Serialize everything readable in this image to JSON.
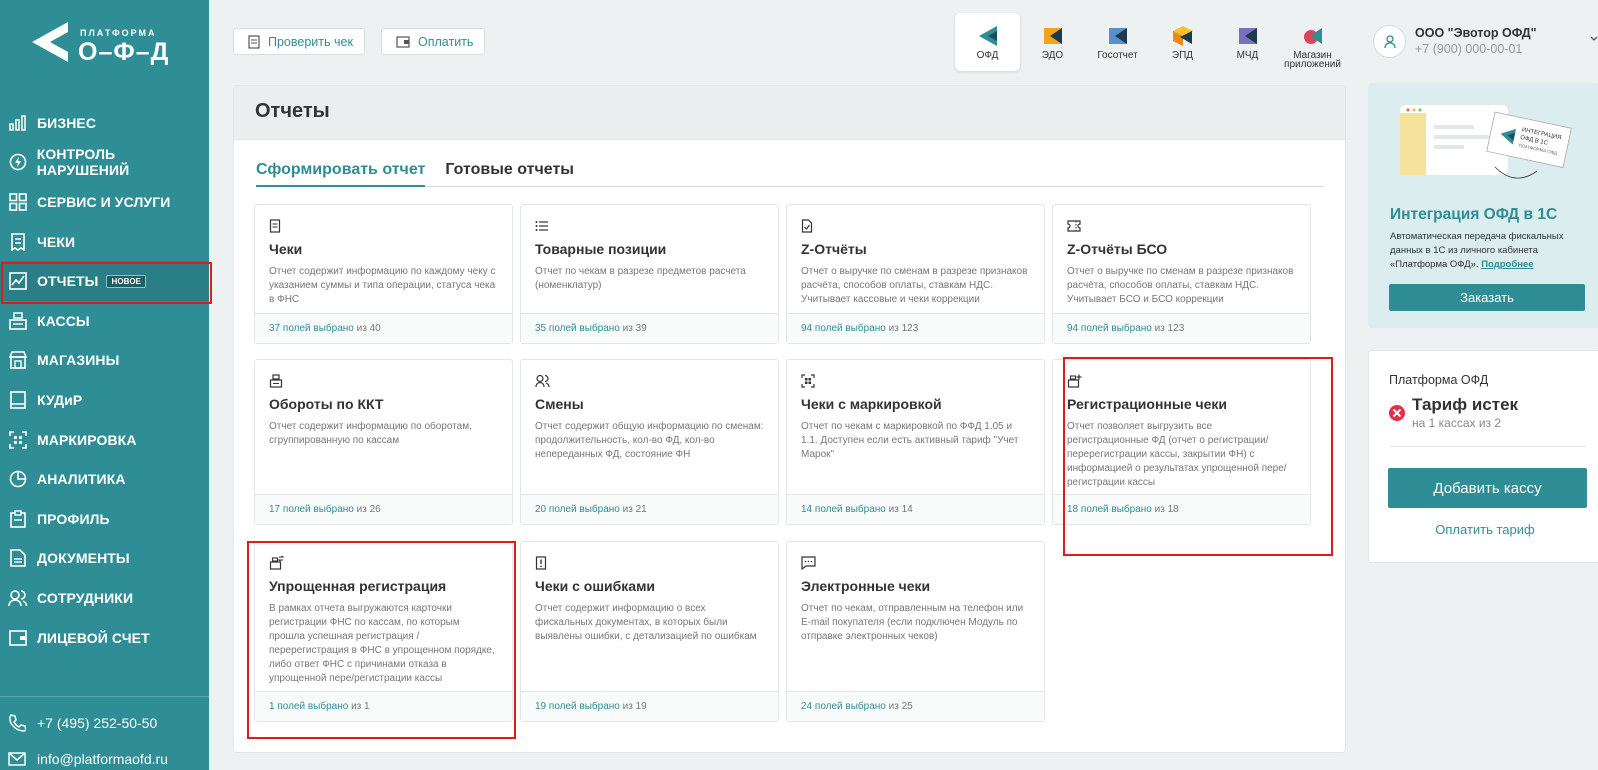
{
  "logo": {
    "line1": "ПЛАТФОРМА",
    "line2": "О–Ф–Д"
  },
  "sidebar": {
    "items": [
      {
        "label": "БИЗНЕС",
        "icon": "bar-chart-icon"
      },
      {
        "label": "КОНТРОЛЬ НАРУШЕНИЙ",
        "icon": "lightning-circle-icon"
      },
      {
        "label": "СЕРВИС И УСЛУГИ",
        "icon": "grid-icon"
      },
      {
        "label": "ЧЕКИ",
        "icon": "receipt-icon"
      },
      {
        "label": "ОТЧЕТЫ",
        "icon": "report-chart-icon",
        "badge": "НОВОЕ"
      },
      {
        "label": "КАССЫ",
        "icon": "cash-register-icon"
      },
      {
        "label": "МАГАЗИНЫ",
        "icon": "store-icon"
      },
      {
        "label": "КУДиР",
        "icon": "book-icon"
      },
      {
        "label": "МАРКИРОВКА",
        "icon": "datamatrix-icon"
      },
      {
        "label": "АНАЛИТИКА",
        "icon": "pie-chart-icon"
      },
      {
        "label": "ПРОФИЛЬ",
        "icon": "clipboard-icon"
      },
      {
        "label": "ДОКУМЕНТЫ",
        "icon": "document-icon"
      },
      {
        "label": "СОТРУДНИКИ",
        "icon": "users-icon"
      },
      {
        "label": "ЛИЦЕВОЙ СЧЕТ",
        "icon": "wallet-icon"
      }
    ],
    "phone": "+7 (495) 252-50-50",
    "email": "info@platformaofd.ru"
  },
  "toolbar": {
    "check_receipt": "Проверить чек",
    "pay": "Оплатить"
  },
  "apps": [
    {
      "label": "ОФД"
    },
    {
      "label": "ЭДО"
    },
    {
      "label": "Госотчет"
    },
    {
      "label": "ЭПД"
    },
    {
      "label": "МЧД"
    },
    {
      "label": "Магазин приложений"
    }
  ],
  "user": {
    "name": "ООО \"Эвотор ОФД\"",
    "phone": "+7 (900) 000-00-01"
  },
  "page": {
    "title": "Отчеты"
  },
  "tabs": [
    "Сформировать отчет",
    "Готовые отчеты"
  ],
  "cards": [
    {
      "title": "Чеки",
      "desc": "Отчет содержит информацию по каждому чеку с указанием суммы и типа операции, статуса чека в ФНС",
      "selected": "37 полей выбрано",
      "total": "из 40"
    },
    {
      "title": "Товарные позиции",
      "desc": "Отчет по чекам в разрезе предметов расчета (номенклатур)",
      "selected": "35 полей выбрано",
      "total": "из 39"
    },
    {
      "title": "Z-Отчёты",
      "desc": "Отчет о выручке по сменам в разрезе признаков расчёта, способов оплаты, ставкам НДС. Учитывает кассовые и чеки коррекции",
      "selected": "94 полей выбрано",
      "total": "из 123"
    },
    {
      "title": "Z-Отчёты БСО",
      "desc": "Отчет о выручке по сменам в разрезе признаков расчёта, способов оплаты, ставкам НДС. Учитывает БСО и БСО коррекции",
      "selected": "94 полей выбрано",
      "total": "из 123"
    },
    {
      "title": "Обороты по ККТ",
      "desc": "Отчет содержит информацию по оборотам, сгруппированную по кассам",
      "selected": "17 полей выбрано",
      "total": "из 26"
    },
    {
      "title": "Смены",
      "desc": "Отчет содержит общую информацию по сменам: продолжительность, кол-во ФД, кол-во непереданных ФД, состояние ФН",
      "selected": "20 полей выбрано",
      "total": "из 21"
    },
    {
      "title": "Чеки с маркировкой",
      "desc": "Отчет по чекам с маркировкой по ФФД 1.05 и 1.1. Доступен если есть активный тариф \"Учет Марок\"",
      "selected": "14 полей выбрано",
      "total": "из 14"
    },
    {
      "title": "Регистрационные чеки",
      "desc": "Отчет позволяет выгрузить все регистрационные ФД (отчет о регистрации/перерегистрации кассы, закрытии ФН) с информацией о результатах упрощенной пере/регистрации кассы",
      "selected": "18 полей выбрано",
      "total": "из 18"
    },
    {
      "title": "Упрощенная регистрация",
      "desc": "В рамках отчета выгружаются карточки регистрации ФНС по кассам, по которым прошла успешная регистрация / перерегистрация в ФНС в упрощенном порядке, либо ответ ФНС с причинами отказа в упрощенной пере/регистрации кассы",
      "selected": "1 полей выбрано",
      "total": "из 1"
    },
    {
      "title": "Чеки с ошибками",
      "desc": "Отчет содержит информацию о всех фискальных документах, в которых были выявлены ошибки, с детализацией по ошибкам",
      "selected": "19 полей выбрано",
      "total": "из 19"
    },
    {
      "title": "Электронные чеки",
      "desc": "Отчет по чекам, отправленным на телефон или E-mail покупателя (если подключен Модуль по отправке электронных чеков)",
      "selected": "24 полей выбрано",
      "total": "из 25"
    }
  ],
  "promo": {
    "title": "Интеграция ОФД в 1С",
    "desc": "Автоматическая передача фискальных данных в 1С из личного кабинета «Платформа ОФД».",
    "link": "Подробнее",
    "button": "Заказать",
    "image_text": "ИНТЕГРАЦИЯ ОФД В 1С ПЛАТФОРМА ОФД"
  },
  "tariff": {
    "name": "Платформа ОФД",
    "status": "Тариф истек",
    "sub": "на 1 кассах из 2",
    "add_button": "Добавить кассу",
    "pay_link": "Оплатить тариф"
  },
  "colors": {
    "accent": "#2f8d96",
    "highlight": "#e01b1b"
  }
}
